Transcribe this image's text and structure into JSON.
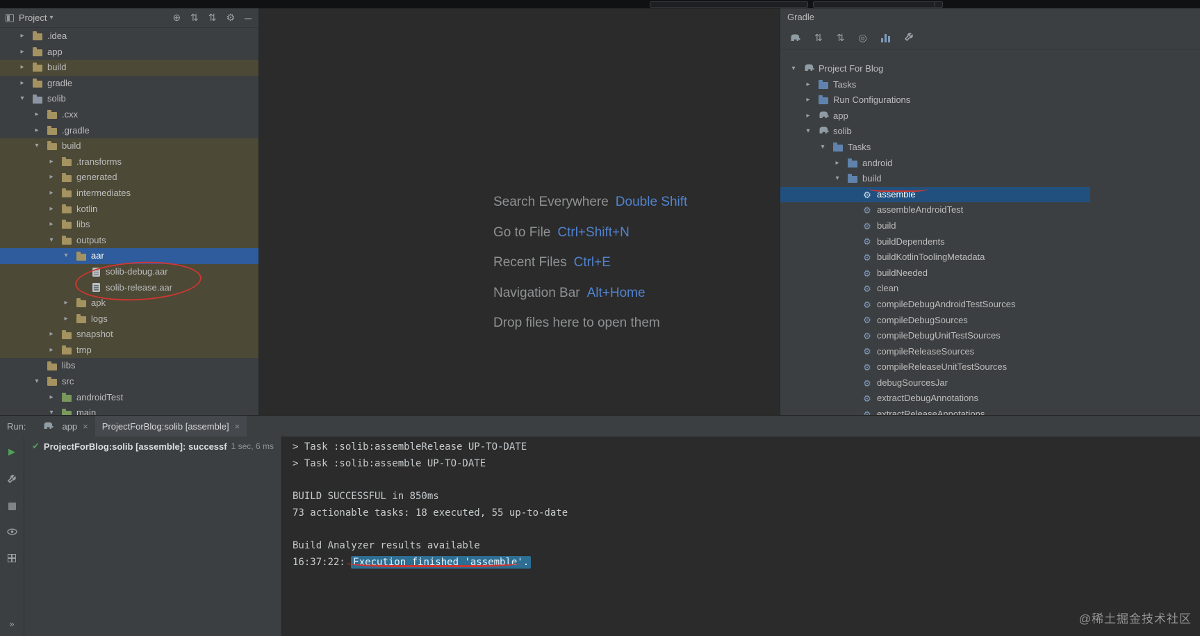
{
  "colors": {
    "panel-bg": "#3c3f41",
    "editor-bg": "#2b2b2b",
    "selection-blue": "#2e5c9c",
    "selection-blue-dark": "#21507f",
    "highlight-olive": "#4c4936",
    "annotation-red": "#cd3731",
    "console-highlight": "#2d6e93",
    "shortcut-key-blue": "#5183cf",
    "success-green": "#4f9f58"
  },
  "project_panel": {
    "title": "Project",
    "header_icons": [
      "locate-icon",
      "collapse-all-icon",
      "expand-all-icon",
      "settings-gear-icon",
      "hide-panel-icon"
    ],
    "tree": [
      {
        "label": ".idea",
        "level": 1,
        "chevron": "right",
        "icon": "folder"
      },
      {
        "label": "app",
        "level": 1,
        "chevron": "right",
        "icon": "folder"
      },
      {
        "label": "build",
        "level": 1,
        "chevron": "right",
        "icon": "folder",
        "hl": true
      },
      {
        "label": "gradle",
        "level": 1,
        "chevron": "right",
        "icon": "folder"
      },
      {
        "label": "solib",
        "level": 1,
        "chevron": "down",
        "icon": "module"
      },
      {
        "label": ".cxx",
        "level": 2,
        "chevron": "right",
        "icon": "folder"
      },
      {
        "label": ".gradle",
        "level": 2,
        "chevron": "right",
        "icon": "folder"
      },
      {
        "label": "build",
        "level": 2,
        "chevron": "down",
        "icon": "folder",
        "hl": true
      },
      {
        "label": ".transforms",
        "level": 3,
        "chevron": "right",
        "icon": "folder",
        "hl": true
      },
      {
        "label": "generated",
        "level": 3,
        "chevron": "right",
        "icon": "folder",
        "hl": true
      },
      {
        "label": "intermediates",
        "level": 3,
        "chevron": "right",
        "icon": "folder",
        "hl": true
      },
      {
        "label": "kotlin",
        "level": 3,
        "chevron": "right",
        "icon": "folder",
        "hl": true
      },
      {
        "label": "libs",
        "level": 3,
        "chevron": "right",
        "icon": "folder",
        "hl": true
      },
      {
        "label": "outputs",
        "level": 3,
        "chevron": "down",
        "icon": "folder",
        "hl": true
      },
      {
        "label": "aar",
        "level": 4,
        "chevron": "down",
        "icon": "folder",
        "selected": true
      },
      {
        "label": "solib-debug.aar",
        "level": 5,
        "chevron": "none",
        "icon": "archive",
        "hl": true
      },
      {
        "label": "solib-release.aar",
        "level": 5,
        "chevron": "none",
        "icon": "archive",
        "hl": true
      },
      {
        "label": "apk",
        "level": 4,
        "chevron": "right",
        "icon": "folder",
        "hl": true
      },
      {
        "label": "logs",
        "level": 4,
        "chevron": "right",
        "icon": "folder",
        "hl": true
      },
      {
        "label": "snapshot",
        "level": 3,
        "chevron": "right",
        "icon": "folder",
        "hl": true
      },
      {
        "label": "tmp",
        "level": 3,
        "chevron": "right",
        "icon": "folder",
        "hl": true
      },
      {
        "label": "libs",
        "level": 2,
        "chevron": "none",
        "icon": "folder"
      },
      {
        "label": "src",
        "level": 2,
        "chevron": "down",
        "icon": "folder"
      },
      {
        "label": "androidTest",
        "level": 3,
        "chevron": "right",
        "icon": "folder-green"
      },
      {
        "label": "main",
        "level": 3,
        "chevron": "down",
        "icon": "folder-green"
      }
    ]
  },
  "editor": {
    "shortcuts": [
      {
        "label": "Search Everywhere",
        "keys": "Double Shift"
      },
      {
        "label": "Go to File",
        "keys": "Ctrl+Shift+N"
      },
      {
        "label": "Recent Files",
        "keys": "Ctrl+E"
      },
      {
        "label": "Navigation Bar",
        "keys": "Alt+Home"
      },
      {
        "label": "Drop files here to open them",
        "keys": ""
      }
    ]
  },
  "gradle_panel": {
    "title": "Gradle",
    "toolbar_icons": [
      "gradle-sync-icon",
      "collapse-all-icon",
      "expand-all-icon",
      "attach-icon",
      "profiler-icon",
      "build-tool-icon"
    ],
    "tree": [
      {
        "label": "Project For Blog",
        "level": 0,
        "chevron": "down",
        "icon": "elephant"
      },
      {
        "label": "Tasks",
        "level": 1,
        "chevron": "right",
        "icon": "tasks"
      },
      {
        "label": "Run Configurations",
        "level": 1,
        "chevron": "right",
        "icon": "tasks"
      },
      {
        "label": "app",
        "level": 1,
        "chevron": "right",
        "icon": "elephant"
      },
      {
        "label": "solib",
        "level": 1,
        "chevron": "down",
        "icon": "elephant"
      },
      {
        "label": "Tasks",
        "level": 2,
        "chevron": "down",
        "icon": "tasks"
      },
      {
        "label": "android",
        "level": 3,
        "chevron": "right",
        "icon": "tasks"
      },
      {
        "label": "build",
        "level": 3,
        "chevron": "down",
        "icon": "tasks"
      },
      {
        "label": "assemble",
        "level": 4,
        "chevron": "none",
        "icon": "gear",
        "selected": true
      },
      {
        "label": "assembleAndroidTest",
        "level": 4,
        "chevron": "none",
        "icon": "gear"
      },
      {
        "label": "build",
        "level": 4,
        "chevron": "none",
        "icon": "gear"
      },
      {
        "label": "buildDependents",
        "level": 4,
        "chevron": "none",
        "icon": "gear"
      },
      {
        "label": "buildKotlinToolingMetadata",
        "level": 4,
        "chevron": "none",
        "icon": "gear"
      },
      {
        "label": "buildNeeded",
        "level": 4,
        "chevron": "none",
        "icon": "gear"
      },
      {
        "label": "clean",
        "level": 4,
        "chevron": "none",
        "icon": "gear"
      },
      {
        "label": "compileDebugAndroidTestSources",
        "level": 4,
        "chevron": "none",
        "icon": "gear"
      },
      {
        "label": "compileDebugSources",
        "level": 4,
        "chevron": "none",
        "icon": "gear"
      },
      {
        "label": "compileDebugUnitTestSources",
        "level": 4,
        "chevron": "none",
        "icon": "gear"
      },
      {
        "label": "compileReleaseSources",
        "level": 4,
        "chevron": "none",
        "icon": "gear"
      },
      {
        "label": "compileReleaseUnitTestSources",
        "level": 4,
        "chevron": "none",
        "icon": "gear"
      },
      {
        "label": "debugSourcesJar",
        "level": 4,
        "chevron": "none",
        "icon": "gear"
      },
      {
        "label": "extractDebugAnnotations",
        "level": 4,
        "chevron": "none",
        "icon": "gear"
      },
      {
        "label": "extractReleaseAnnotations",
        "level": 4,
        "chevron": "none",
        "icon": "gear"
      }
    ]
  },
  "run_panel": {
    "label": "Run:",
    "tabs": [
      {
        "label": "app",
        "icon": "elephant",
        "active": false
      },
      {
        "label": "ProjectForBlog:solib [assemble]",
        "icon": "none",
        "active": true
      }
    ],
    "toolbar_icons": [
      "run-icon",
      "build-hammer-icon",
      "stop-icon",
      "preview-icon",
      "layout-grid-icon",
      "more-icon"
    ],
    "status": {
      "text": "ProjectForBlog:solib [assemble]: successf",
      "duration": "1 sec, 6 ms"
    },
    "console": {
      "lines": [
        {
          "text": "> Task :solib:assembleRelease UP-TO-DATE"
        },
        {
          "text": "> Task :solib:assemble UP-TO-DATE"
        },
        {
          "text": ""
        },
        {
          "text": "BUILD SUCCESSFUL in 850ms"
        },
        {
          "text": "73 actionable tasks: 18 executed, 55 up-to-date"
        },
        {
          "text": ""
        },
        {
          "text": "Build Analyzer results available"
        },
        {
          "prefix": "16:37:22: ",
          "highlight": "Execution finished 'assemble'."
        }
      ]
    }
  },
  "watermark": "@稀土掘金技术社区"
}
